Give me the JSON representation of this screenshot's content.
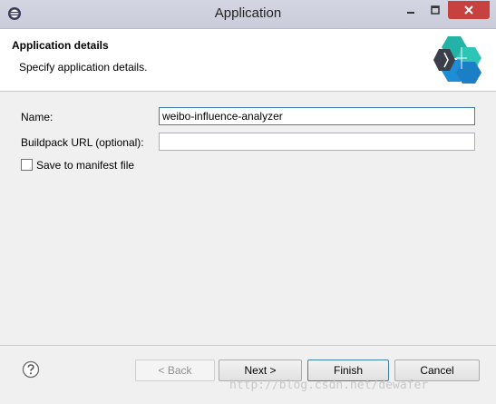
{
  "window": {
    "title": "Application"
  },
  "banner": {
    "title": "Application details",
    "subtitle": "Specify application details."
  },
  "form": {
    "name_label": "Name:",
    "name_value": "weibo-influence-analyzer",
    "buildpack_label": "Buildpack URL (optional):",
    "buildpack_value": "",
    "manifest_label": "Save to manifest file",
    "manifest_checked": false
  },
  "buttons": {
    "back": "< Back",
    "next": "Next >",
    "finish": "Finish",
    "cancel": "Cancel"
  },
  "watermark": "http://blog.csdn.net/dewafer",
  "icons": {
    "app": "eclipse-icon",
    "minimize": "minimize-icon",
    "maximize": "maximize-icon",
    "close": "close-icon",
    "logo": "bluemix-logo",
    "help": "help-icon"
  },
  "colors": {
    "close_button": "#c7413f",
    "logo_teal": "#22b3a6",
    "logo_blue": "#1f8dd6",
    "logo_dark": "#3a3f4a"
  }
}
